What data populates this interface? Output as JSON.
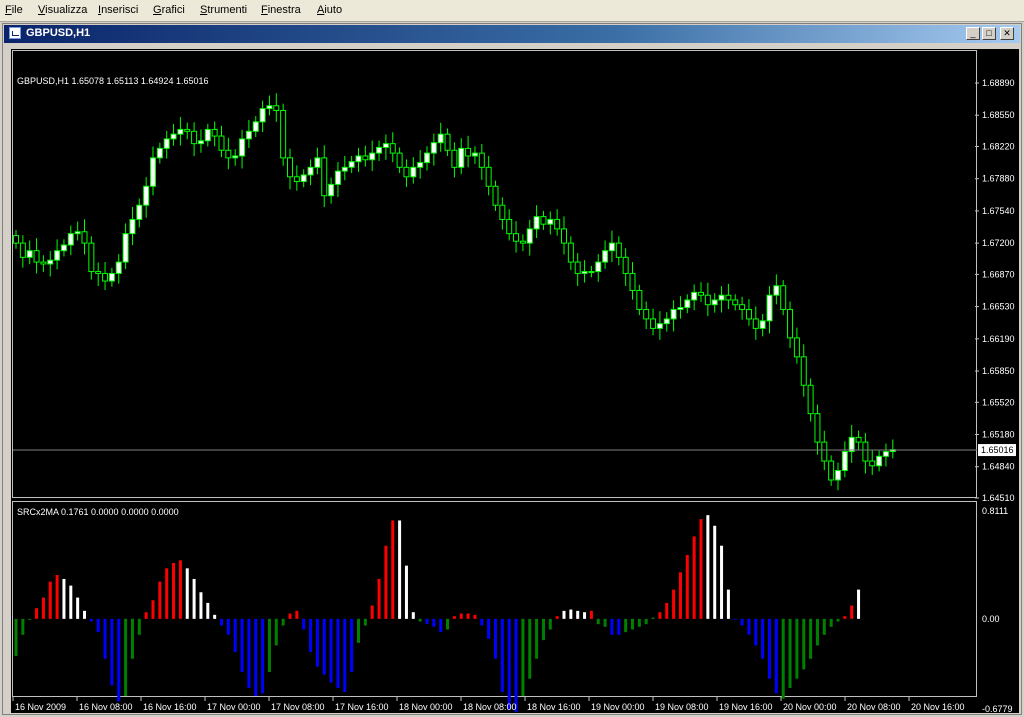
{
  "menu": [
    "File",
    "Visualizza",
    "Inserisci",
    "Grafici",
    "Strumenti",
    "Finestra",
    "Aiuto"
  ],
  "window": {
    "title": "GBPUSD,H1"
  },
  "price_panel": {
    "label": "GBPUSD,H1  1.65078 1.65113 1.64924 1.65016",
    "axis_labels": [
      "1.68890",
      "1.68550",
      "1.68220",
      "1.67880",
      "1.67540",
      "1.67200",
      "1.66870",
      "1.66530",
      "1.66190",
      "1.65850",
      "1.65520",
      "1.65180",
      "1.64840",
      "1.64510"
    ],
    "current_price": "1.65016",
    "axis_min": 1.6451,
    "axis_max": 1.6889
  },
  "indicator_panel": {
    "label": "SRCx2MA 0.1761 0.0000 0.0000 0.0000",
    "axis_top": "0.8111",
    "axis_zero": "0.00",
    "axis_bottom": "-0.6779"
  },
  "time_labels": [
    "16 Nov 2009",
    "16 Nov 08:00",
    "16 Nov 16:00",
    "17 Nov 00:00",
    "17 Nov 08:00",
    "17 Nov 16:00",
    "18 Nov 00:00",
    "18 Nov 08:00",
    "18 Nov 16:00",
    "19 Nov 00:00",
    "19 Nov 08:00",
    "19 Nov 16:00",
    "20 Nov 00:00",
    "20 Nov 08:00",
    "20 Nov 16:00"
  ],
  "colors": {
    "bull": "#ffffff",
    "bear": "#000000",
    "wick": "#00ff00",
    "hist_red": "#ff0000",
    "hist_white": "#ffffff",
    "hist_blue": "#0000ff",
    "hist_green": "#008000"
  },
  "chart_data": [
    {
      "type": "candlestick",
      "series": [
        {
          "close": [
            1.672,
            1.6705,
            1.6712,
            1.67,
            1.6698,
            1.6702,
            1.6712,
            1.6718,
            1.673,
            1.6732,
            1.672,
            1.669,
            1.6688,
            1.668,
            1.6688,
            1.67,
            1.673,
            1.6745,
            1.676,
            1.678,
            1.681,
            1.682,
            1.683,
            1.6835,
            1.684,
            1.6838,
            1.6825,
            1.6828,
            1.684,
            1.6833,
            1.6818,
            1.681,
            1.6812,
            1.683,
            1.6838,
            1.6848,
            1.6862,
            1.6865,
            1.686,
            1.681,
            1.679,
            1.6785,
            1.6792,
            1.68,
            1.681,
            1.677,
            1.6782,
            1.6796,
            1.68,
            1.6806,
            1.6812,
            1.6808,
            1.6815,
            1.6821,
            1.6825,
            1.6815,
            1.68,
            1.679,
            1.68,
            1.6805,
            1.6815,
            1.6826,
            1.6835,
            1.6818,
            1.68,
            1.682,
            1.6812,
            1.6815,
            1.68,
            1.678,
            1.676,
            1.6745,
            1.673,
            1.6722,
            1.672,
            1.6735,
            1.6748,
            1.674,
            1.6745,
            1.6735,
            1.672,
            1.67,
            1.6688,
            1.669,
            1.669,
            1.67,
            1.6712,
            1.672,
            1.6705,
            1.6688,
            1.667,
            1.665,
            1.664,
            1.663,
            1.6635,
            1.664,
            1.665,
            1.6652,
            1.666,
            1.6668,
            1.6665,
            1.6655,
            1.666,
            1.6665,
            1.666,
            1.6655,
            1.665,
            1.664,
            1.663,
            1.6638,
            1.6665,
            1.6675,
            1.665,
            1.662,
            1.66,
            1.657,
            1.654,
            1.651,
            1.649,
            1.647,
            1.648,
            1.65,
            1.6515,
            1.651,
            1.649,
            1.6485,
            1.6495,
            1.65,
            1.6502
          ],
          "range": [
            1.665,
            1.688
          ]
        }
      ]
    },
    {
      "type": "bar",
      "values": [
        -0.28,
        -0.12,
        0.0,
        0.08,
        0.16,
        0.28,
        0.33,
        0.3,
        0.25,
        0.16,
        0.06,
        -0.02,
        -0.1,
        -0.3,
        -0.5,
        -0.62,
        -0.58,
        -0.3,
        -0.12,
        0.05,
        0.14,
        0.28,
        0.38,
        0.42,
        0.44,
        0.38,
        0.3,
        0.2,
        0.12,
        0.03,
        -0.05,
        -0.12,
        -0.25,
        -0.4,
        -0.52,
        -0.58,
        -0.56,
        -0.4,
        -0.2,
        -0.05,
        0.04,
        0.06,
        -0.08,
        -0.25,
        -0.36,
        -0.42,
        -0.48,
        -0.52,
        -0.55,
        -0.4,
        -0.18,
        -0.05,
        0.1,
        0.3,
        0.55,
        0.74,
        0.74,
        0.4,
        0.05,
        -0.02,
        -0.04,
        -0.06,
        -0.1,
        -0.08,
        0.02,
        0.04,
        0.04,
        0.03,
        -0.05,
        -0.15,
        -0.3,
        -0.55,
        -0.68,
        -0.7,
        -0.58,
        -0.45,
        -0.3,
        -0.16,
        -0.08,
        0.02,
        0.06,
        0.07,
        0.06,
        0.05,
        0.06,
        -0.04,
        -0.06,
        -0.12,
        -0.12,
        -0.1,
        -0.08,
        -0.06,
        -0.04,
        0.01,
        0.05,
        0.12,
        0.22,
        0.35,
        0.48,
        0.62,
        0.75,
        0.78,
        0.7,
        0.55,
        0.22,
        0.0,
        -0.05,
        -0.12,
        -0.2,
        -0.3,
        -0.45,
        -0.56,
        -0.6,
        -0.52,
        -0.45,
        -0.38,
        -0.3,
        -0.2,
        -0.12,
        -0.06,
        -0.02,
        0.02,
        0.1,
        0.22
      ],
      "colors": [
        "green",
        "green",
        "green",
        "red",
        "red",
        "red",
        "red",
        "white",
        "white",
        "white",
        "white",
        "blue",
        "blue",
        "blue",
        "blue",
        "blue",
        "green",
        "green",
        "green",
        "red",
        "red",
        "red",
        "red",
        "red",
        "red",
        "white",
        "white",
        "white",
        "white",
        "white",
        "blue",
        "blue",
        "blue",
        "blue",
        "blue",
        "blue",
        "blue",
        "green",
        "green",
        "green",
        "red",
        "red",
        "blue",
        "blue",
        "blue",
        "blue",
        "blue",
        "blue",
        "blue",
        "blue",
        "green",
        "green",
        "red",
        "red",
        "red",
        "red",
        "white",
        "white",
        "white",
        "green",
        "blue",
        "blue",
        "blue",
        "green",
        "red",
        "red",
        "red",
        "red",
        "blue",
        "blue",
        "blue",
        "blue",
        "blue",
        "blue",
        "green",
        "green",
        "green",
        "green",
        "green",
        "red",
        "white",
        "white",
        "white",
        "white",
        "red",
        "green",
        "green",
        "blue",
        "blue",
        "green",
        "green",
        "green",
        "green",
        "green",
        "red",
        "red",
        "red",
        "red",
        "red",
        "red",
        "red",
        "white",
        "white",
        "white",
        "white",
        "blue",
        "blue",
        "blue",
        "blue",
        "blue",
        "blue",
        "blue",
        "green",
        "green",
        "green",
        "green",
        "green",
        "green",
        "green",
        "green",
        "green",
        "red",
        "red"
      ],
      "ylim": [
        -0.6779,
        0.8111
      ]
    }
  ]
}
